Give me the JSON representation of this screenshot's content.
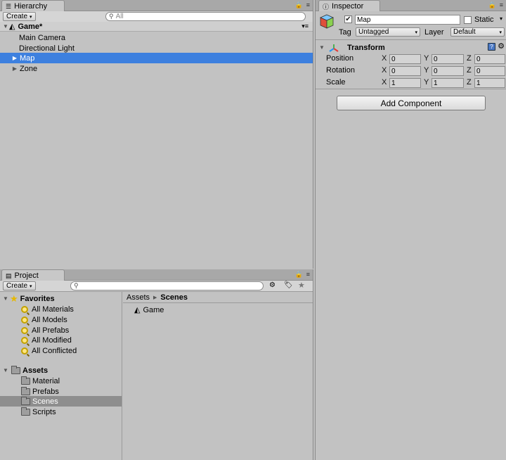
{
  "hierarchy": {
    "tab_label": "Hierarchy",
    "create_label": "Create",
    "search_placeholder": "All",
    "scene_name": "Game*",
    "items": [
      {
        "label": "Main Camera"
      },
      {
        "label": "Directional Light"
      },
      {
        "label": "Map"
      },
      {
        "label": "Zone"
      }
    ]
  },
  "inspector": {
    "tab_label": "Inspector",
    "object_name": "Map",
    "active_checked": true,
    "static_label": "Static",
    "tag_label": "Tag",
    "tag_value": "Untagged",
    "layer_label": "Layer",
    "layer_value": "Default",
    "transform": {
      "title": "Transform",
      "rows": [
        {
          "label": "Position",
          "x": "0",
          "y": "0",
          "z": "0"
        },
        {
          "label": "Rotation",
          "x": "0",
          "y": "0",
          "z": "0"
        },
        {
          "label": "Scale",
          "x": "1",
          "y": "1",
          "z": "1"
        }
      ],
      "axis_labels": [
        "X",
        "Y",
        "Z"
      ]
    },
    "add_component_label": "Add Component"
  },
  "project": {
    "tab_label": "Project",
    "create_label": "Create",
    "favorites_label": "Favorites",
    "favorites": [
      {
        "label": "All Materials"
      },
      {
        "label": "All Models"
      },
      {
        "label": "All Prefabs"
      },
      {
        "label": "All Modified"
      },
      {
        "label": "All Conflicted"
      }
    ],
    "assets_label": "Assets",
    "folders": [
      {
        "label": "Material"
      },
      {
        "label": "Prefabs"
      },
      {
        "label": "Scenes"
      },
      {
        "label": "Scripts"
      }
    ],
    "breadcrumb_root": "Assets",
    "breadcrumb_current": "Scenes",
    "files": [
      {
        "label": "Game"
      }
    ]
  },
  "colors": {
    "selection": "#3d80df",
    "panel_bg": "#c2c2c2"
  }
}
